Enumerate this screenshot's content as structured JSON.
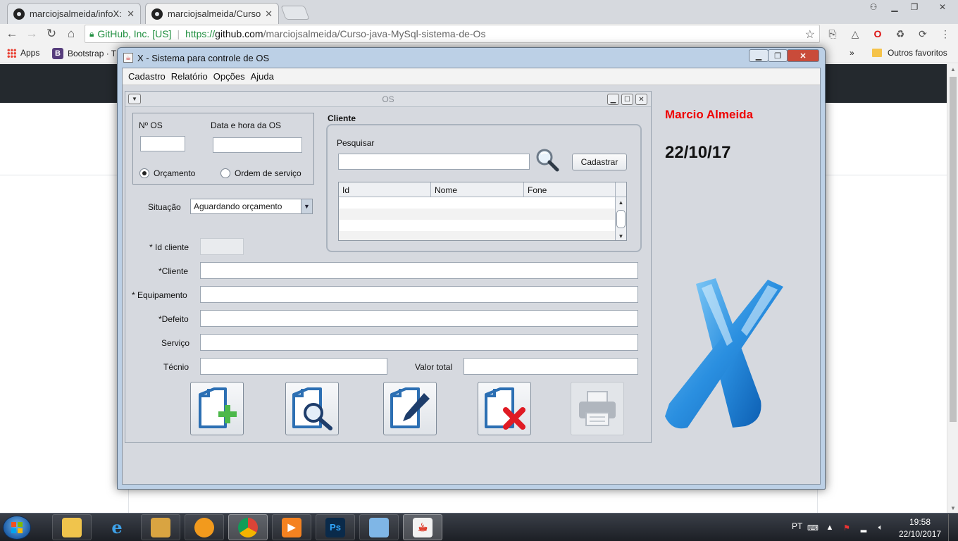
{
  "browser": {
    "tabs": [
      {
        "label": "marciojsalmeida/infoX: C",
        "active": false
      },
      {
        "label": "marciojsalmeida/Curso-ja",
        "active": true
      }
    ],
    "security_label": "GitHub, Inc. [US]",
    "url": {
      "protocol": "https://",
      "host": "github.com",
      "path": "/marciojsalmeida/Curso-java-MySql-sistema-de-Os"
    },
    "bookmarks": {
      "apps": "Apps",
      "bootstrap": "Bootstrap · T",
      "overflow": "»",
      "other_favorites": "Outros favoritos"
    }
  },
  "app": {
    "title": "X - Sistema para controle de OS",
    "menu": [
      "Cadastro",
      "Relatório",
      "Opções",
      "Ajuda"
    ],
    "user_name": "Marcio Almeida",
    "date": "22/10/17",
    "accent_color": "#e00000"
  },
  "os_form": {
    "title": "OS",
    "labels": {
      "os_number": "Nº OS",
      "os_datetime": "Data e hora da OS",
      "situation": "Situação",
      "client_id": "* Id cliente",
      "client": "*Cliente",
      "equipment": "* Equipamento",
      "defect": "*Defeito",
      "service": "Serviço",
      "technician": "Técnio",
      "total_value": "Valor total"
    },
    "values": {
      "os_number": "",
      "os_datetime": "",
      "client_id": "",
      "client": "",
      "equipment": "",
      "defect": "",
      "service": "",
      "technician": "",
      "total_value": ""
    },
    "type_options": [
      {
        "label": "Orçamento",
        "selected": true
      },
      {
        "label": "Ordem de serviço",
        "selected": false
      }
    ],
    "situation_selected": "Aguardando orçamento",
    "client_group": {
      "title": "Cliente",
      "search_label": "Pesquisar",
      "search_value": "",
      "register_button": "Cadastrar",
      "table_columns": [
        "Id",
        "Nome",
        "Fone"
      ],
      "table_rows": []
    },
    "action_icons": [
      "add-os-icon",
      "search-os-icon",
      "edit-os-icon",
      "delete-os-icon",
      "print-os-icon"
    ]
  },
  "taskbar": {
    "language": "PT",
    "time": "19:58",
    "date": "22/10/2017"
  }
}
